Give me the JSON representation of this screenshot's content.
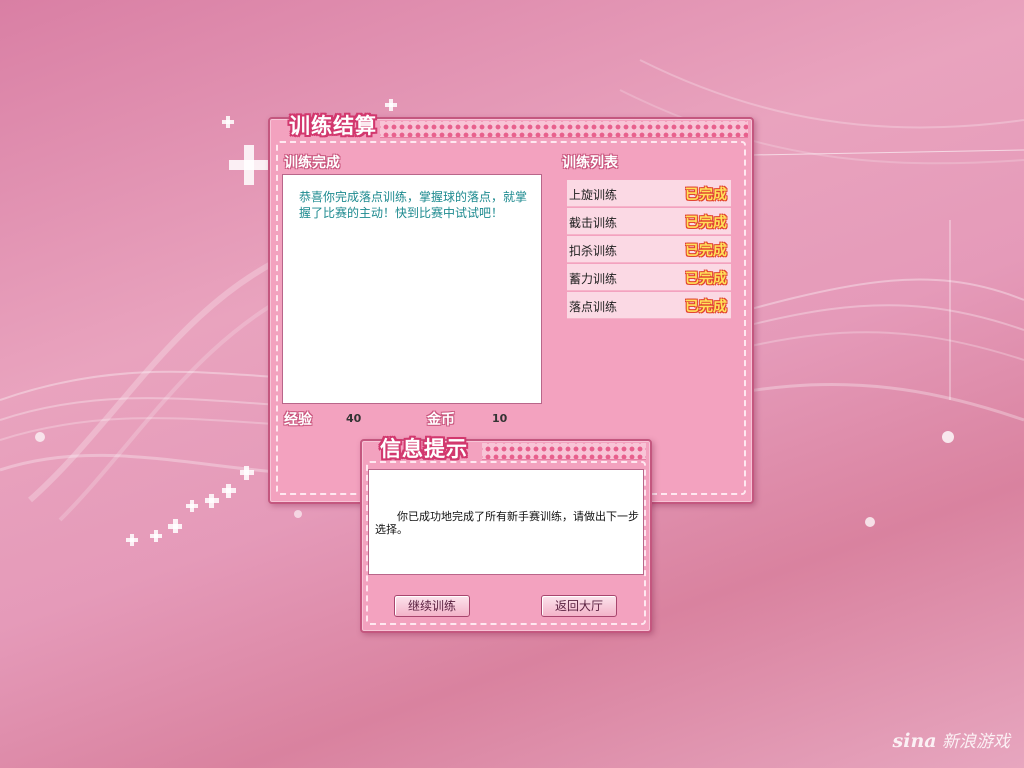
{
  "training_summary": {
    "title": "训练结算",
    "completion_label": "训练完成",
    "message": "恭喜你完成落点训练，掌握球的落点，就掌握了比赛的主动！快到比赛中试试吧！",
    "exp_label": "经验",
    "exp_value": "40",
    "gold_label": "金币",
    "gold_value": "10",
    "list_label": "训练列表",
    "items": [
      {
        "name": "上旋训练",
        "status": "已完成"
      },
      {
        "name": "截击训练",
        "status": "已完成"
      },
      {
        "name": "扣杀训练",
        "status": "已完成"
      },
      {
        "name": "蓄力训练",
        "status": "已完成"
      },
      {
        "name": "落点训练",
        "status": "已完成"
      }
    ]
  },
  "info_dialog": {
    "title": "信息提示",
    "message": "你已成功地完成了所有新手赛训练，请做出下一步选择。",
    "continue_label": "继续训练",
    "return_label": "返回大厅"
  },
  "watermark": {
    "brand": "sina",
    "text": "新浪游戏"
  },
  "colors": {
    "panel_pink": "#f3a2bf",
    "title_outline": "#d2386e",
    "message_teal": "#1d8a8f",
    "status_yellow": "#ffe15a"
  }
}
